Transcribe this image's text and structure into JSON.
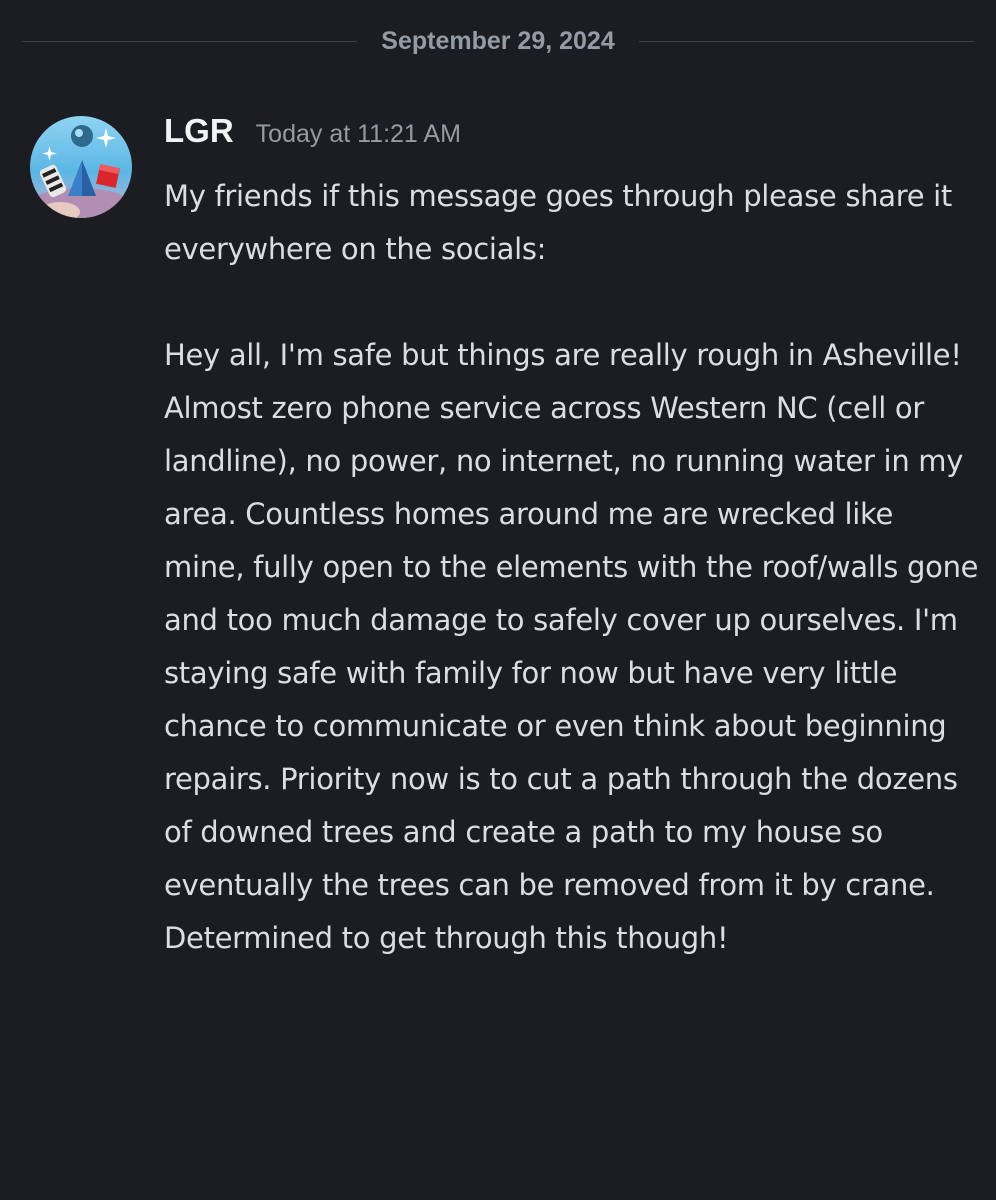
{
  "divider": {
    "date": "September 29, 2024"
  },
  "message": {
    "username": "LGR",
    "timestamp": "Today at 11:21 AM",
    "paragraph_1": "My friends if this message goes through please share it everywhere on the socials:",
    "paragraph_2": "Hey all, I'm safe but things are really rough in Asheville! Almost zero phone service across Western NC (cell or landline), no power, no internet, no running water in my area. Countless homes around me are wrecked like mine, fully open to the elements with the roof/walls gone and too much damage to safely cover up ourselves. I'm staying safe with family for now but have very little chance to communicate or even think about beginning repairs. Priority now is to cut a path through the dozens of downed trees and create a path to my house so eventually the trees can be removed from it by crane. Determined to get through this though!"
  },
  "colors": {
    "background": "#1c1d22",
    "username": "#f2f3f5",
    "muted": "#949ba4",
    "text": "#dbdee1"
  }
}
